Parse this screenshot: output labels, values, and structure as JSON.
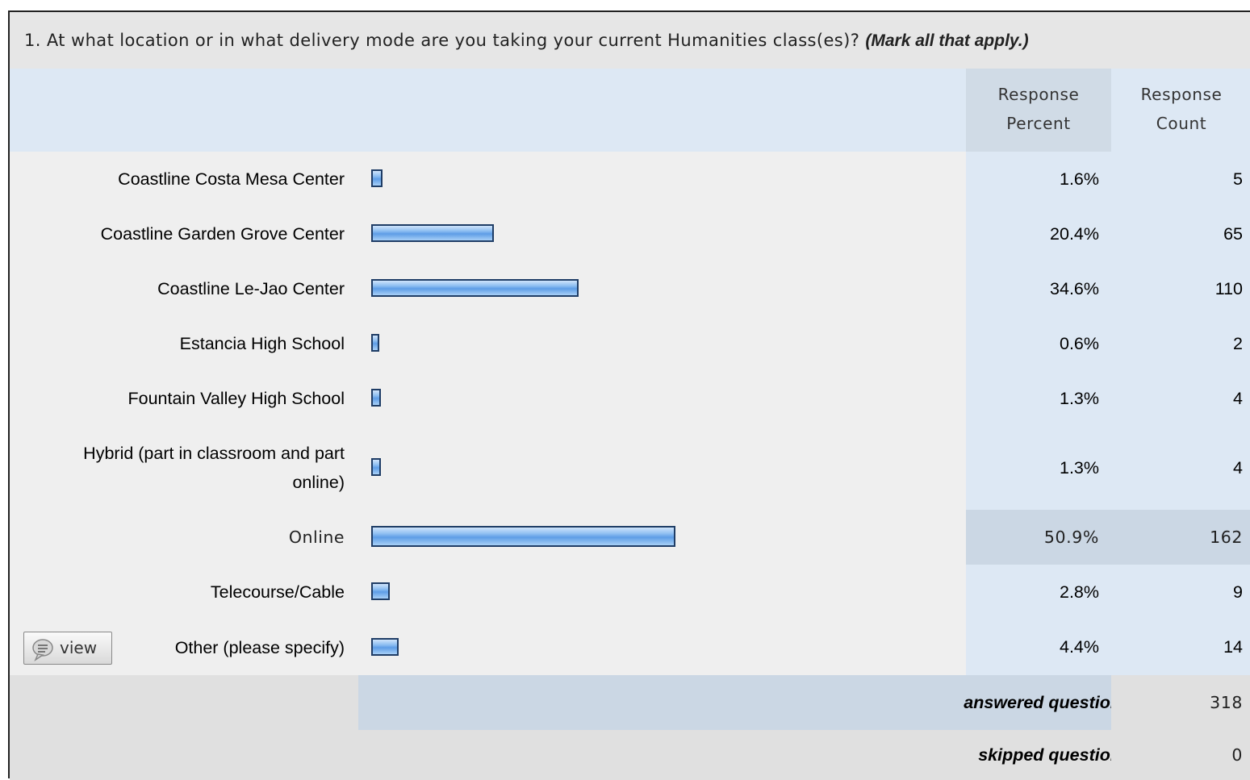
{
  "question": {
    "text": "1. At what location or in what delivery mode are you taking your current Humanities class(es)?",
    "note": "(Mark all that apply.)"
  },
  "headers": {
    "percent_line1": "Response",
    "percent_line2": "Percent",
    "count_line1": "Response",
    "count_line2": "Count"
  },
  "view_button": {
    "label": "view",
    "icon": "speech-bubble-icon"
  },
  "summary": {
    "answered_label": "answered question",
    "answered_value": "318",
    "skipped_label": "skipped question",
    "skipped_value": "0"
  },
  "colors": {
    "bar_fill": "#6ea8ea",
    "bar_border": "#1f3d66",
    "percent_bg": "#dde8f4",
    "highlight_bg": "#cbd7e4"
  },
  "chart_data": {
    "type": "bar",
    "orientation": "horizontal",
    "categories": [
      "Coastline Costa Mesa Center",
      "Coastline Garden Grove Center",
      "Coastline Le-Jao Center",
      "Estancia High School",
      "Fountain Valley High School",
      "Hybrid (part in classroom and part online)",
      "Online",
      "Telecourse/Cable",
      "Other (please specify)"
    ],
    "values": [
      1.6,
      20.4,
      34.6,
      0.6,
      1.3,
      1.3,
      50.9,
      2.8,
      4.4
    ],
    "percent_labels": [
      "1.6%",
      "20.4%",
      "34.6%",
      "0.6%",
      "1.3%",
      "1.3%",
      "50.9%",
      "2.8%",
      "4.4%"
    ],
    "counts": [
      "5",
      "65",
      "110",
      "2",
      "4",
      "4",
      "162",
      "9",
      "14"
    ],
    "highlighted_index": 6
  }
}
